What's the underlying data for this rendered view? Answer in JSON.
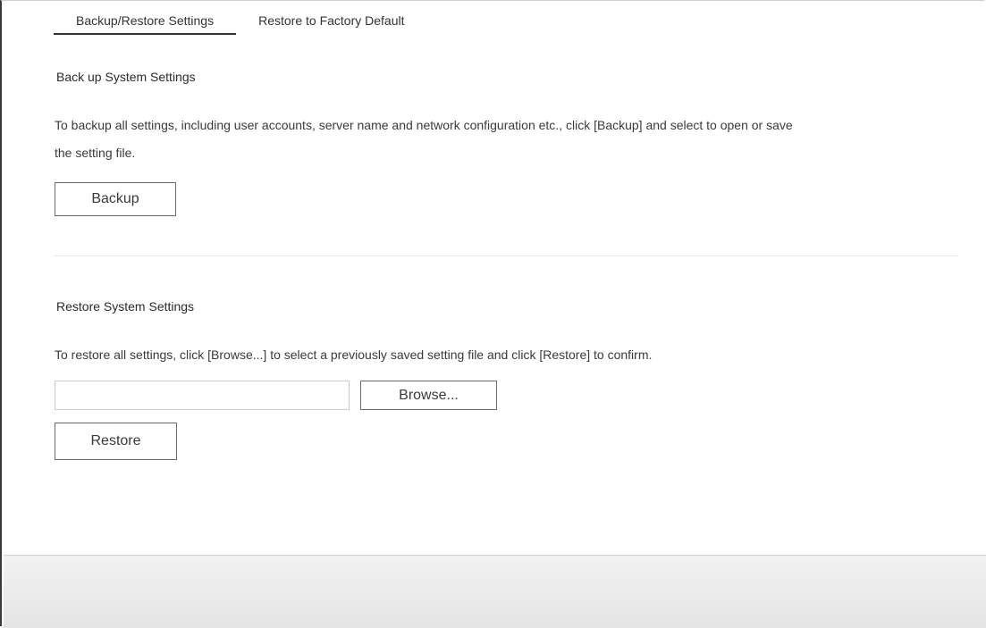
{
  "tabs": [
    {
      "label": "Backup/Restore Settings",
      "active": true
    },
    {
      "label": "Restore to Factory Default",
      "active": false
    }
  ],
  "backup": {
    "title": "Back up System Settings",
    "description_line1": "To backup all settings, including user accounts, server name and network configuration etc., click [Backup] and select to open or save",
    "description_line2": "the setting file.",
    "button_label": "Backup"
  },
  "restore": {
    "title": "Restore System Settings",
    "description": "To restore all settings, click [Browse...] to select a previously saved setting file and click [Restore] to confirm.",
    "file_input_value": "",
    "browse_label": "Browse...",
    "button_label": "Restore"
  }
}
